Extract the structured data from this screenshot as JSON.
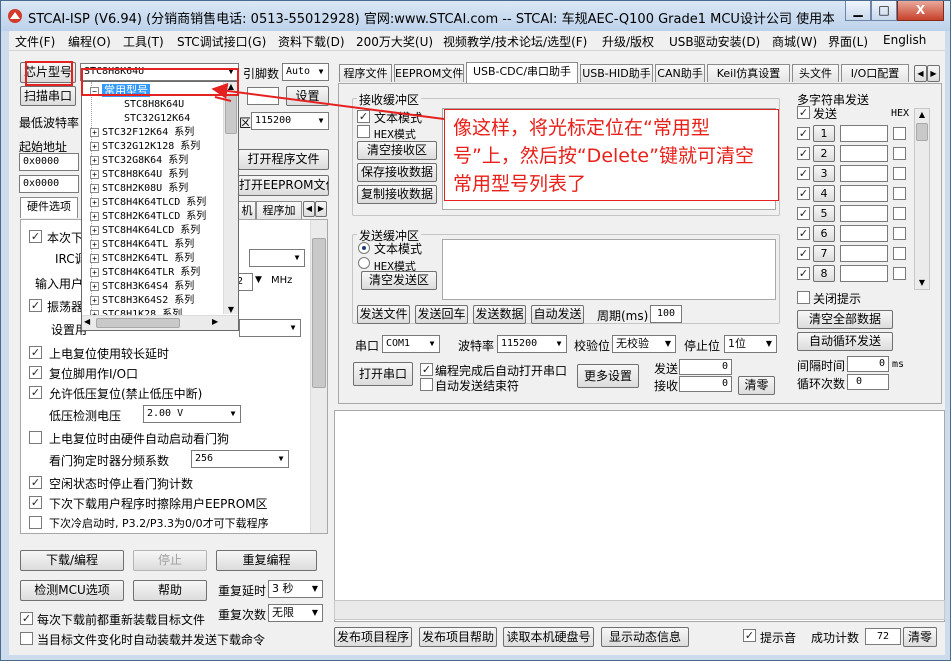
{
  "window": {
    "title": "STCAI-ISP (V6.94) (分销商销售电话: 0513-55012928) 官网:www.STCAI.com  -- STCAI: 车规AEC-Q100 Grade1 MCU设计公司 使用本司芯片或采",
    "min_label": "▁",
    "max_label": "□",
    "close_label": "X"
  },
  "menu": [
    "文件(F)",
    "编程(O)",
    "工具(T)",
    "STC调试接口(G)",
    "资料下载(D)",
    "200万大奖(U)",
    "视频教学/技术论坛/选型(F)",
    "升级/版权",
    "USB驱动安装(D)",
    "商城(W)",
    "界面(L)",
    "English"
  ],
  "left": {
    "chip_model_btn": "芯片型号",
    "chip_model_value": "STC8H8K64U",
    "pin_label": "引脚数",
    "pin_value": "Auto",
    "scan_port_btn": "扫描串口",
    "settings_btn": "设置",
    "min_baud_label": "最低波特率",
    "max_baud_label": "区",
    "max_baud_value": "115200",
    "start_addr_label": "起始地址",
    "addr1": "0x0000",
    "addr2": "0x0000",
    "open_prog_btn": "打开程序文件",
    "open_eeprom_btn": "打开EEPROM文件",
    "tabs": [
      "硬件选项",
      "机",
      "程序加"
    ],
    "opt_this_time": "本次下",
    "irc_label": "IRC调",
    "user_freq_label": "输入用户",
    "freq_value": "2",
    "freq_unit": "MHz",
    "oscillator_label": "振荡器",
    "set_label": "设置用",
    "options": [
      {
        "checked": true,
        "label": "上电复位使用较长延时"
      },
      {
        "checked": true,
        "label": "复位脚用作I/O口"
      },
      {
        "checked": true,
        "label": "允许低压复位(禁止低压中断)"
      }
    ],
    "low_volt_label": "低压检测电压",
    "low_volt_value": "2.00 V",
    "wdt_auto_label": "上电复位时由硬件自动启动看门狗",
    "wdt_div_label": "看门狗定时器分频系数",
    "wdt_div_value": "256",
    "options2": [
      {
        "checked": true,
        "label": "空闲状态时停止看门狗计数"
      },
      {
        "checked": true,
        "label": "下次下载用户程序时擦除用户EEPROM区"
      },
      {
        "checked": false,
        "label": "下次冷启动时, P3.2/P3.3为0/0才可下载程序"
      }
    ],
    "download_btn": "下载/编程",
    "stop_btn": "停止",
    "reprogram_btn": "重复编程",
    "check_mcu_btn": "检测MCU选项",
    "help_btn": "帮助",
    "repeat_delay_label": "重复延时",
    "repeat_delay_value": "3 秒",
    "repeat_count_label": "重复次数",
    "repeat_count_value": "无限",
    "reload_label": "每次下载前都重新装载目标文件",
    "auto_load_label": "当目标文件变化时自动装载并发送下载命令"
  },
  "dropdown": {
    "selected": "常用型号",
    "sub_items": [
      "STC8H8K64U",
      "STC32G12K64"
    ],
    "groups": [
      "STC32F12K64 系列",
      "STC32G12K128 系列",
      "STC32G8K64 系列",
      "STC8H8K64U 系列",
      "STC8H2K08U 系列",
      "STC8H4K64TLCD 系列",
      "STC8H2K64TLCD 系列",
      "STC8H4K64LCD 系列",
      "STC8H4K64TL 系列",
      "STC8H2K64TL 系列",
      "STC8H4K64TLR 系列",
      "STC8H3K64S4 系列",
      "STC8H3K64S2 系列",
      "STC8H1K28 系列"
    ]
  },
  "right": {
    "tabs": [
      "程序文件",
      "EEPROM文件",
      "USB-CDC/串口助手",
      "USB-HID助手",
      "CAN助手",
      "Keil仿真设置",
      "头文件",
      "I/O口配置"
    ],
    "recv_title": "接收缓冲区",
    "text_mode": "文本模式",
    "hex_mode": "HEX模式",
    "clear_recv": "清空接收区",
    "save_recv": "保存接收数据",
    "copy_recv": "复制接收数据",
    "send_title": "发送缓冲区",
    "send_text_mode": "文本模式",
    "send_hex_mode": "HEX模式",
    "clear_send": "清空发送区",
    "send_file": "发送文件",
    "send_back": "发送回车",
    "send_data": "发送数据",
    "auto_send": "自动发送",
    "period_label": "周期(ms)",
    "period_value": "100",
    "port_label": "串口",
    "port_value": "COM1",
    "baud_label": "波特率",
    "baud_value": "115200",
    "parity_label": "校验位",
    "parity_value": "无校验",
    "stop_label": "停止位",
    "stop_value": "1位",
    "open_port_btn": "打开串口",
    "auto_open_label": "编程完成后自动打开串口",
    "auto_end_label": "自动发送结束符",
    "more_settings": "更多设置",
    "send_count_label": "发送",
    "send_count": "0",
    "recv_count_label": "接收",
    "recv_count": "0",
    "clear_count": "清零",
    "multi_title": "多字符串发送",
    "multi_send": "发送",
    "multi_hex": "HEX",
    "multi_rows": [
      "1",
      "2",
      "3",
      "4",
      "5",
      "6",
      "7",
      "8"
    ],
    "close_hint": "关闭提示",
    "clear_all": "清空全部数据",
    "auto_loop": "自动循环发送",
    "interval_label": "间隔时间",
    "interval_value": "0",
    "interval_unit": "ms",
    "loop_count_label": "循环次数",
    "loop_count_value": "0"
  },
  "bottom": {
    "publish_prog": "发布项目程序",
    "publish_help": "发布项目帮助",
    "read_disk": "读取本机硬盘号",
    "show_dynamic": "显示动态信息",
    "beep_label": "提示音",
    "success_label": "成功计数",
    "success_value": "72",
    "clear_btn": "清零"
  },
  "annotation": {
    "text": "像这样，将光标定位在“常用型号”上，然后按“Delete”键就可清空常用型号列表了"
  }
}
